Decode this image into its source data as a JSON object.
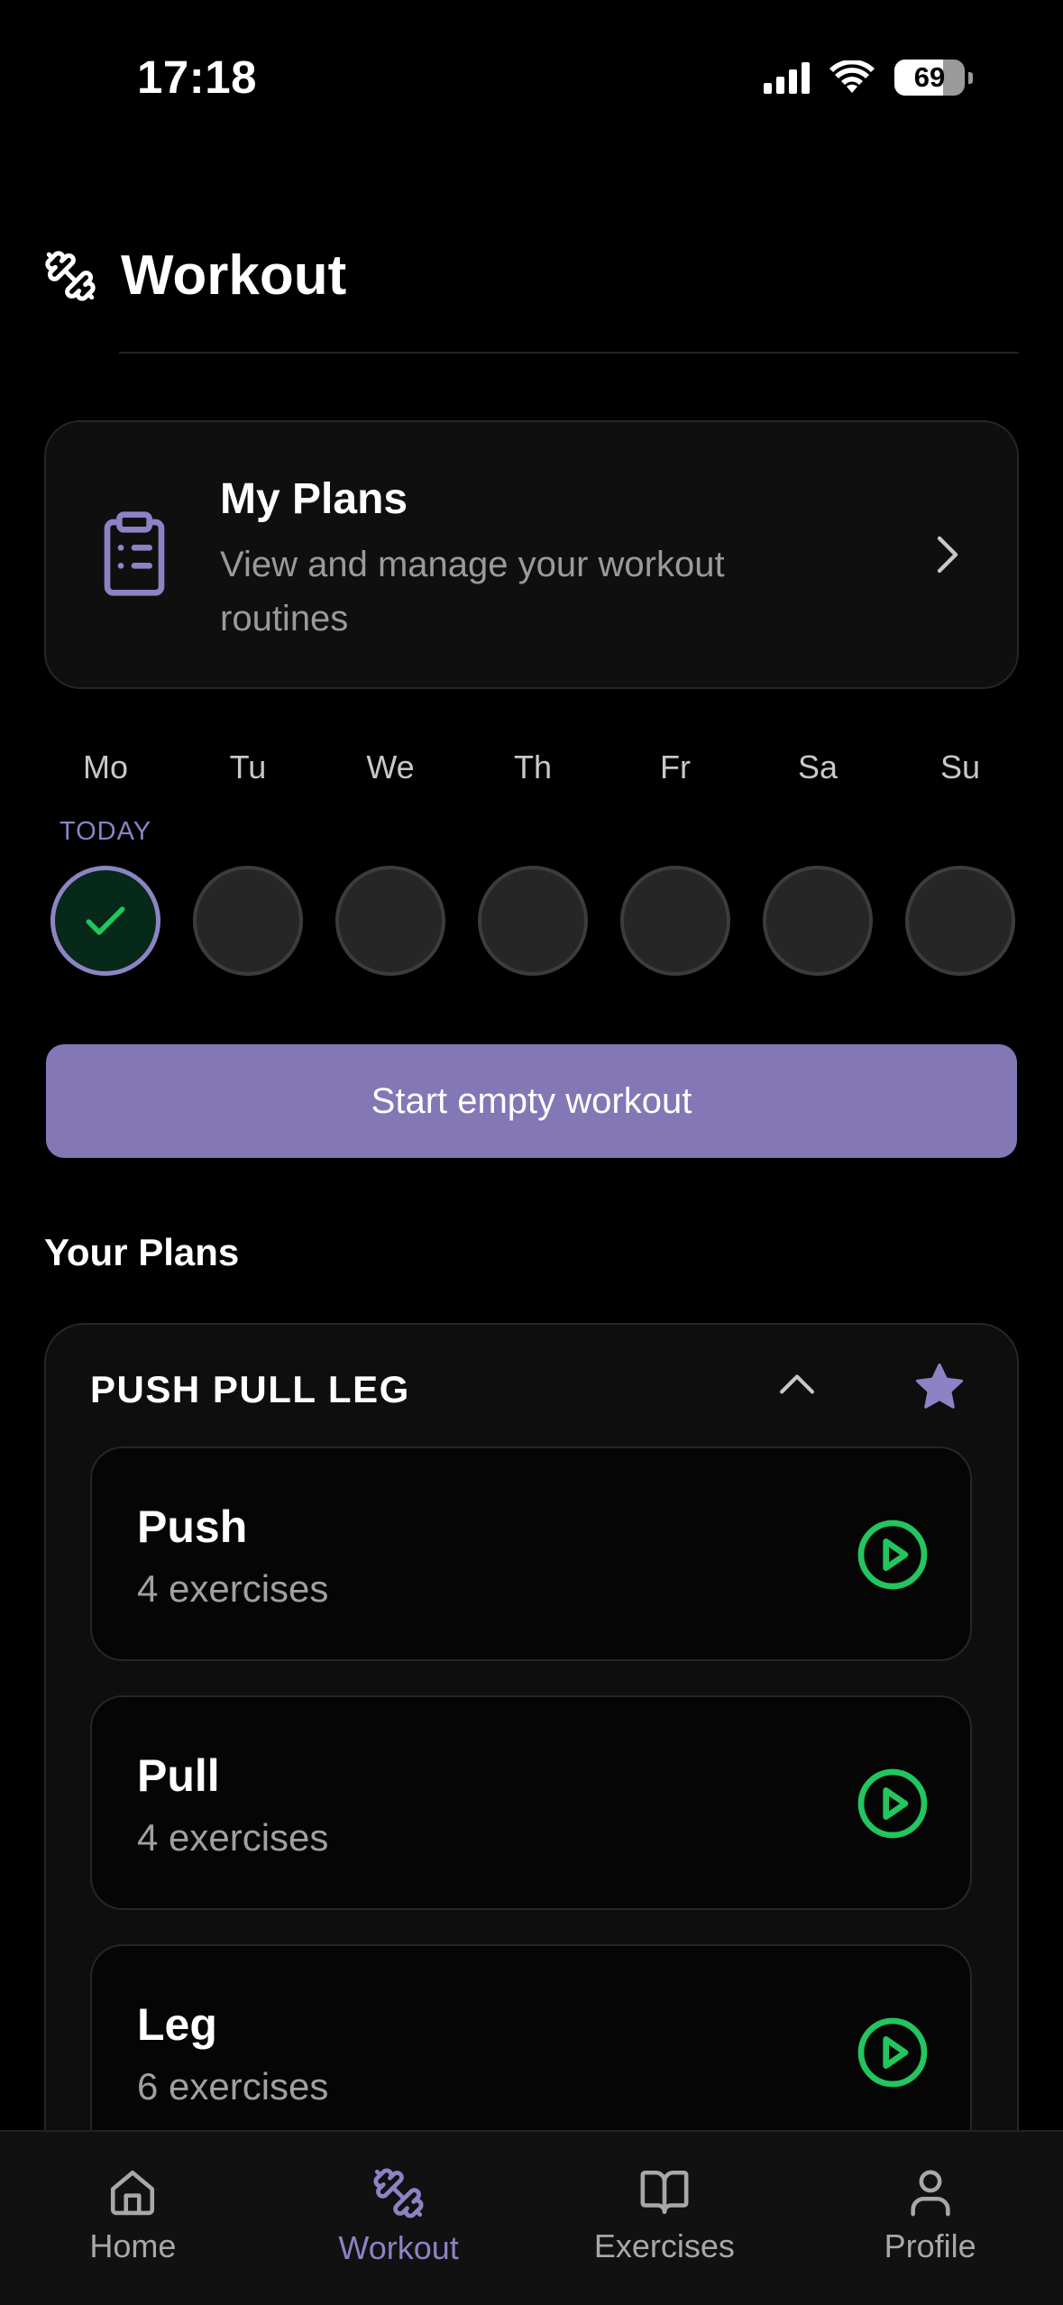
{
  "status_bar": {
    "time": "17:18",
    "battery": "69",
    "battery_level": 0.69
  },
  "header": {
    "title": "Workout"
  },
  "my_plans_card": {
    "title": "My Plans",
    "subtitle": "View and manage your workout routines"
  },
  "week": {
    "days": [
      "Mo",
      "Tu",
      "We",
      "Th",
      "Fr",
      "Sa",
      "Su"
    ],
    "today_label": "TODAY",
    "completed": [
      true,
      false,
      false,
      false,
      false,
      false,
      false
    ]
  },
  "start_button": {
    "label": "Start empty workout"
  },
  "your_plans": {
    "title": "Your Plans",
    "group": {
      "name": "PUSH PULL LEG",
      "workouts": [
        {
          "name": "Push",
          "count": "4 exercises"
        },
        {
          "name": "Pull",
          "count": "4 exercises"
        },
        {
          "name": "Leg",
          "count": "6 exercises"
        }
      ]
    }
  },
  "tab_bar": {
    "tabs": [
      {
        "label": "Home",
        "icon": "home-icon"
      },
      {
        "label": "Workout",
        "icon": "dumbbell-icon",
        "active": true
      },
      {
        "label": "Exercises",
        "icon": "book-icon"
      },
      {
        "label": "Profile",
        "icon": "user-icon"
      }
    ]
  },
  "colors": {
    "accent": "#8477b6",
    "accent_text": "#8c82c4",
    "success": "#22c55e",
    "background": "#000000",
    "card": "#0f0f0f"
  }
}
